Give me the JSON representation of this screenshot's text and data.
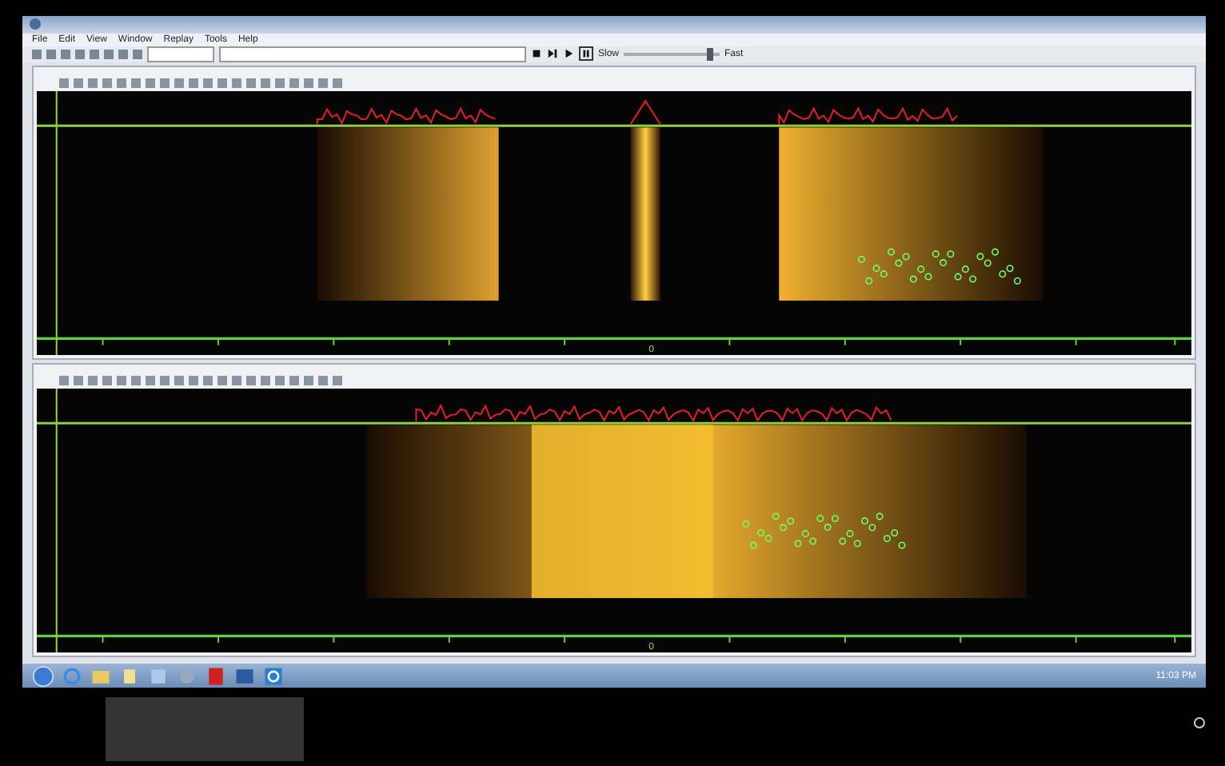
{
  "menu": [
    "File",
    "Edit",
    "View",
    "Window",
    "Replay",
    "Tools",
    "Help"
  ],
  "playback": {
    "slow_label": "Slow",
    "fast_label": "Fast",
    "speed": {
      "level": 0.9
    }
  },
  "panes": [
    {
      "kind": "three-swath",
      "axis_center_label": "0"
    },
    {
      "kind": "single-swath",
      "axis_center_label": "0"
    }
  ],
  "taskbar": {
    "clock": "11:03 PM"
  }
}
